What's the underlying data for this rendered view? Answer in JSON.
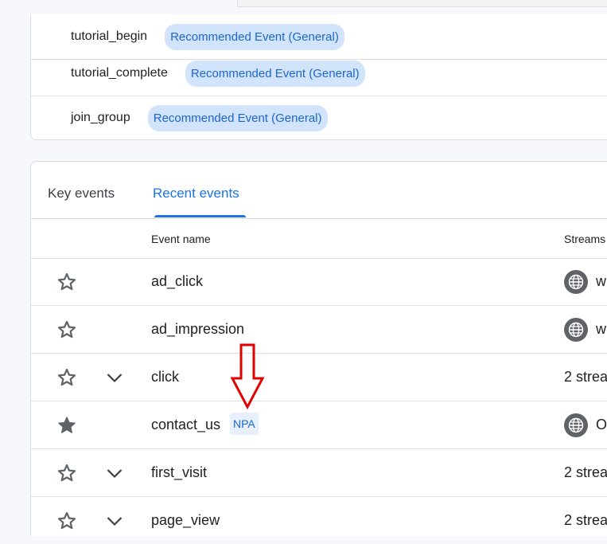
{
  "recommended": {
    "items": [
      {
        "name": "tutorial_begin",
        "badge": "Recommended Event (General)"
      },
      {
        "name": "tutorial_complete",
        "badge": "Recommended Event (General)"
      },
      {
        "name": "join_group",
        "badge": "Recommended Event (General)"
      }
    ]
  },
  "tabs": {
    "key_events": "Key events",
    "recent_events": "Recent events",
    "active": "recent_events"
  },
  "table": {
    "headers": {
      "event_name": "Event name",
      "streams": "Streams"
    },
    "rows": [
      {
        "name": "ad_click",
        "starred": false,
        "expandable": false,
        "streams": "w",
        "globe": true
      },
      {
        "name": "ad_impression",
        "starred": false,
        "expandable": false,
        "streams": "w",
        "globe": true
      },
      {
        "name": "click",
        "starred": false,
        "expandable": true,
        "streams": "2 strea",
        "globe": false
      },
      {
        "name": "contact_us",
        "starred": true,
        "expandable": false,
        "badge": "NPA",
        "streams": "Op",
        "globe": true
      },
      {
        "name": "first_visit",
        "starred": false,
        "expandable": true,
        "streams": "2 strea",
        "globe": false
      },
      {
        "name": "page_view",
        "starred": false,
        "expandable": true,
        "streams": "2 strea",
        "globe": false
      }
    ]
  },
  "colors": {
    "accent": "#1a73e8",
    "chip_bg": "#d2e3fc",
    "annotation_arrow": "#e00000"
  },
  "icons": {
    "star_outline": "star-outline-icon",
    "star_filled": "star-filled-icon",
    "chevron": "chevron-down-icon",
    "globe": "globe-icon"
  }
}
